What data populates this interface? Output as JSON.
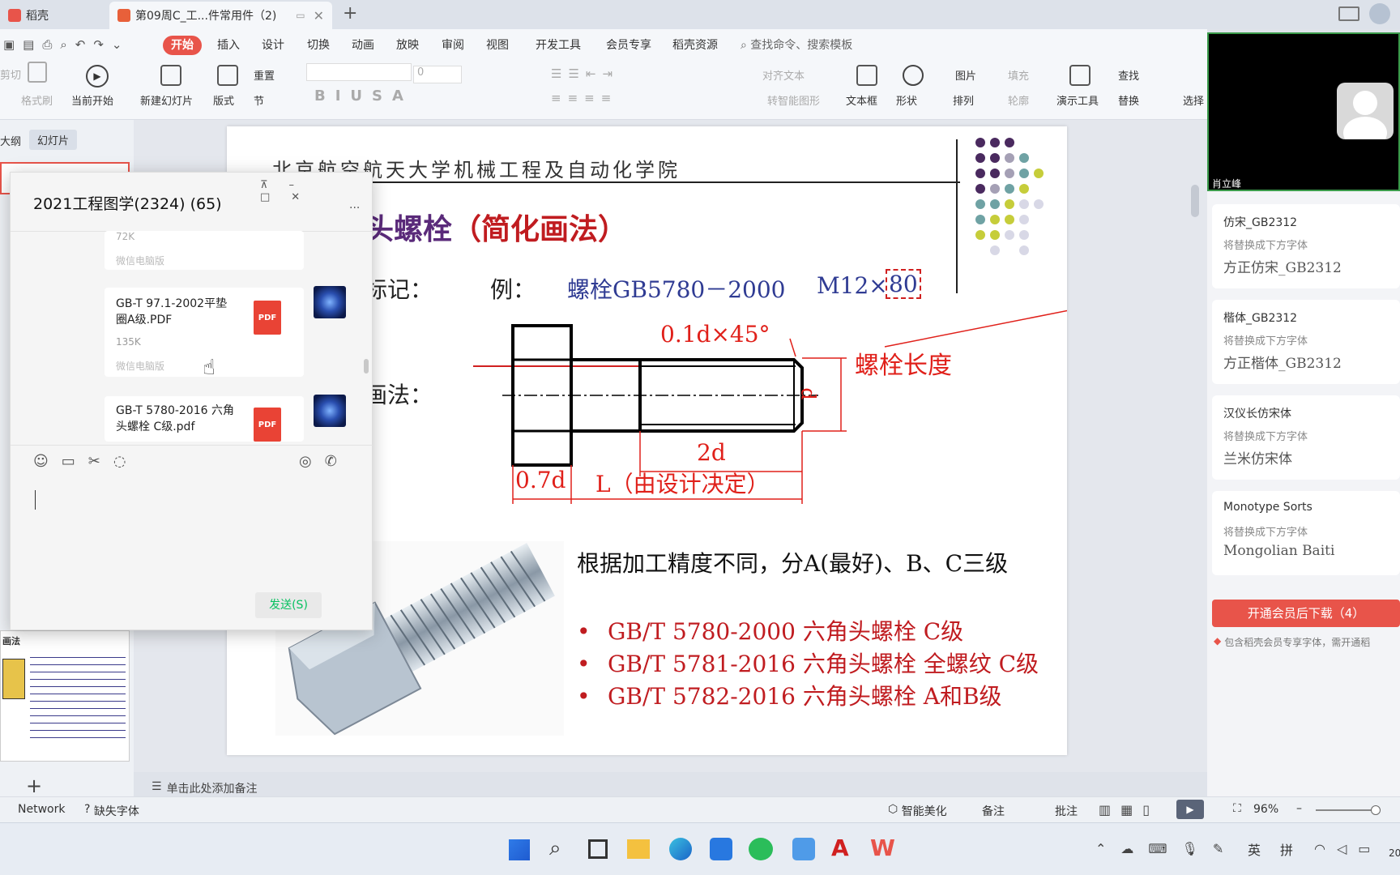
{
  "tabs": {
    "home": "稻壳",
    "doc": "第09周C_工...件常用件（2)"
  },
  "menu": {
    "items": [
      "开始",
      "插入",
      "设计",
      "切换",
      "动画",
      "放映",
      "审阅",
      "视图",
      "开发工具",
      "会员专享",
      "稻壳资源"
    ],
    "search": "查找命令、搜索模板"
  },
  "ribbon": {
    "format_painter": "格式刷",
    "cut": "剪切",
    "play_from": "当前开始",
    "new_slide": "新建幻灯片",
    "layout": "版式",
    "reset": "重置",
    "section": "节",
    "font_size": "0",
    "align_text": "对齐文本",
    "smart_art": "转智能图形",
    "textbox": "文本框",
    "shape": "形状",
    "picture": "图片",
    "arrange": "排列",
    "fill": "填充",
    "outline": "轮廓",
    "present_tools": "演示工具",
    "find": "查找",
    "replace": "替换",
    "select": "选择"
  },
  "leftpane": {
    "tab_outline": "大纲",
    "tab_slides": "幻灯片",
    "thumb_title": "画法",
    "add": "+"
  },
  "chat": {
    "title": "2021工程图学(2324) (65)",
    "more": "···",
    "prev_size": "72K",
    "prev_source": "微信电脑版",
    "files": [
      {
        "name": "GB-T 97.1-2002平垫圈A级.PDF",
        "size": "135K",
        "source": "微信电脑版",
        "badge": "PDF"
      },
      {
        "name": "GB-T 5780-2016 六角头螺栓 C级.pdf",
        "badge": "PDF"
      }
    ],
    "send": "发送(S)"
  },
  "slide": {
    "institution": "北京航空航天大学机械工程及自动化学院",
    "title_a": "头螺栓",
    "title_b": "（简化画法）",
    "mark_label": "标记：",
    "example": "例：",
    "example_code": "螺栓GB5780－2000",
    "example_size": "M12×",
    "example_len": "80",
    "drawing_label": "画法：",
    "chamfer": "0.1d×45°",
    "length_label": "螺栓长度",
    "d": "d",
    "two_d": "2d",
    "head": "0.7d",
    "L": "L（由设计决定）",
    "para": "根据加工精度不同，分A(最好)、B、C三级",
    "bullets": [
      "GB/T 5780-2000 六角头螺栓 C级",
      "GB/T 5781-2016 六角头螺栓 全螺纹 C级",
      "GB/T 5782-2016 六角头螺栓 A和B级"
    ]
  },
  "notes": "单击此处添加备注",
  "video": {
    "name": "肖立峰"
  },
  "rightpane": {
    "fonts": [
      {
        "name": "仿宋_GB2312",
        "sub": "将替换成下方字体",
        "preview": "方正仿宋_GB2312"
      },
      {
        "name": "楷体_GB2312",
        "sub": "将替换成下方字体",
        "preview": "方正楷体_GB2312"
      },
      {
        "name": "汉仪长仿宋体",
        "sub": "将替换成下方字体",
        "preview": "兰米仿宋体"
      },
      {
        "name": "Monotype Sorts",
        "sub": "将替换成下方字体",
        "preview": "Mongolian Baiti"
      }
    ],
    "download": "开通会员后下载（4）",
    "member_note": "包含稻壳会员专享字体，需开通稻"
  },
  "status": {
    "network": "Network",
    "missing_font": "缺失字体",
    "beautify": "智能美化",
    "notes": "备注",
    "comment": "批注",
    "zoom": "96%"
  },
  "taskbar": {
    "lang": "英",
    "ime": "拼",
    "time": "20"
  },
  "colors": {
    "accent": "#e8544a",
    "slide_red": "#c01c20",
    "slide_purple": "#5a2a7a",
    "slide_blue": "#2f3b93",
    "drawing_red": "#e0201a"
  }
}
